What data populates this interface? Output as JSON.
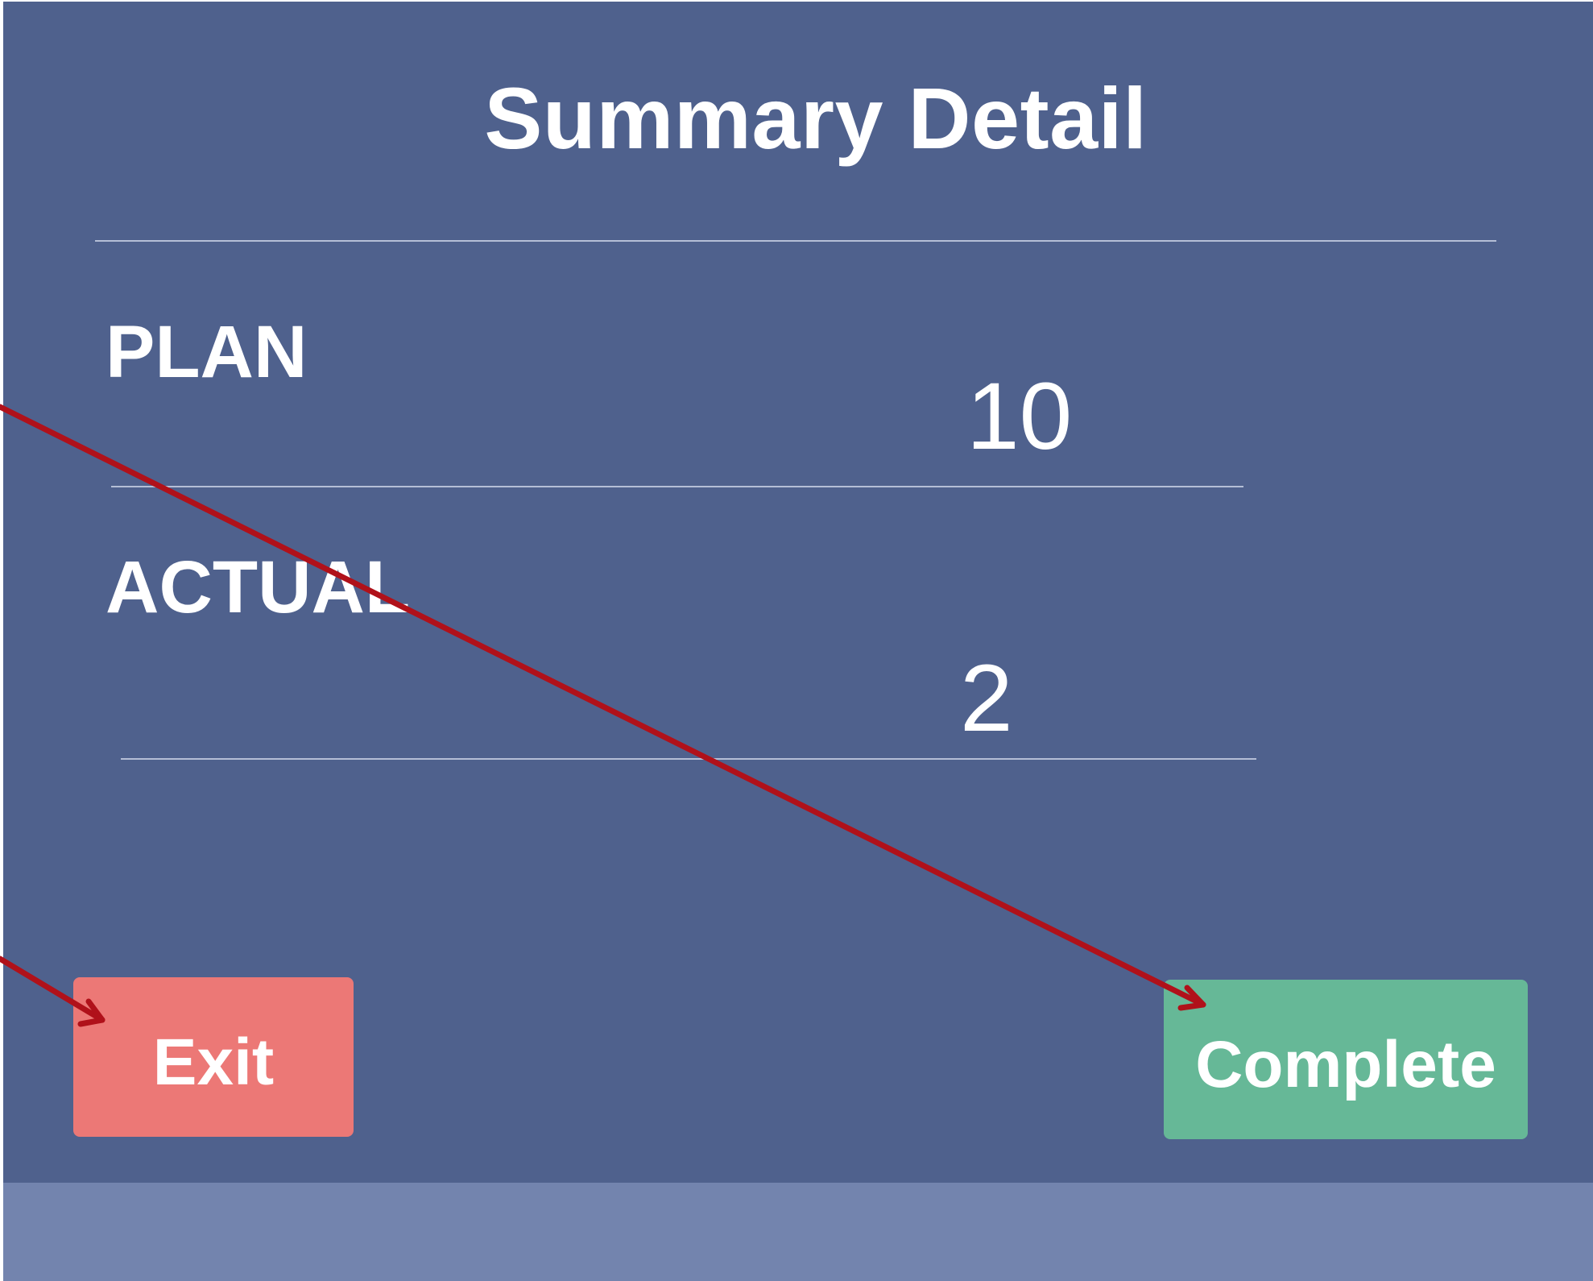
{
  "title": "Summary Detail",
  "fields": [
    {
      "label": "PLAN",
      "value": "10"
    },
    {
      "label": "ACTUAL",
      "value": "2"
    }
  ],
  "buttons": {
    "exit": "Exit",
    "complete": "Complete"
  },
  "colors": {
    "panel_background": "#4f618d",
    "footer_strip": "#7384ae",
    "exit_button": "#ec7876",
    "complete_button": "#66b897",
    "annotation_arrow": "#b0111a"
  }
}
